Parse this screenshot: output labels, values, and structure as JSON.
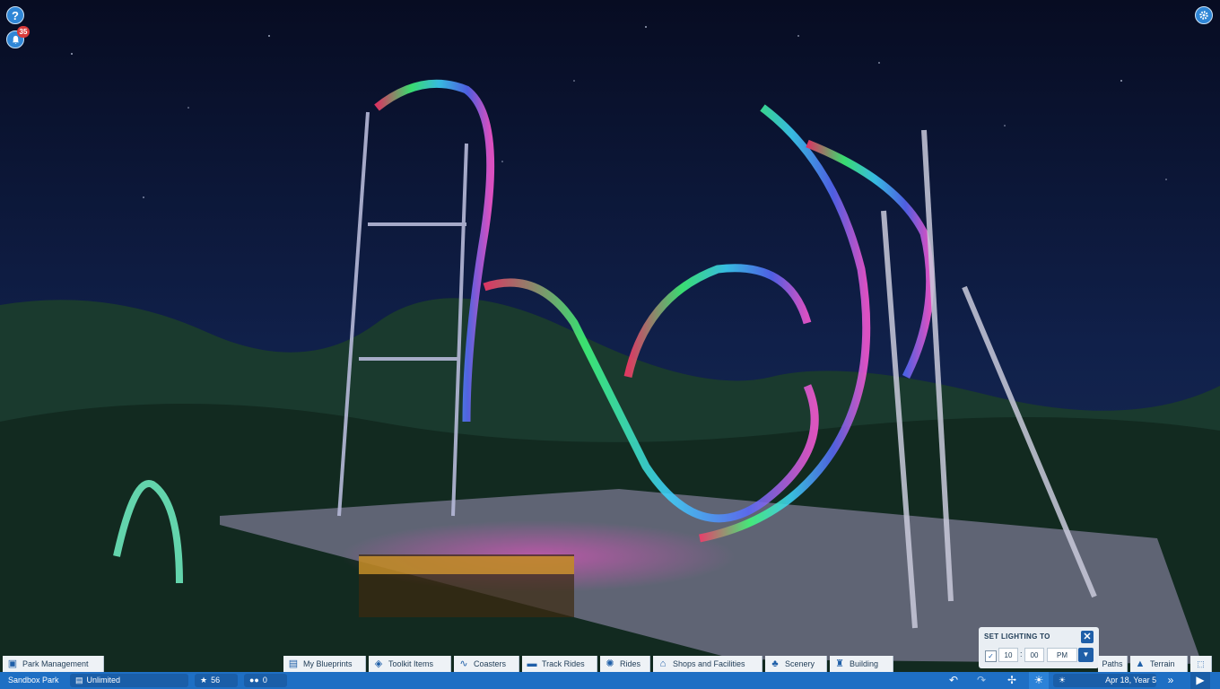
{
  "hud": {
    "help_icon": "question-mark-icon",
    "help_glyph": "?",
    "notification_icon": "bell-icon",
    "notification_count": "35",
    "settings_icon": "gear-icon"
  },
  "lighting_popup": {
    "title": "SET LIGHTING TO",
    "enabled": true,
    "hour": "10",
    "minute": "00",
    "period": "PM"
  },
  "toolbar": {
    "park_management": "Park Management",
    "my_blueprints": "My Blueprints",
    "toolkit_items": "Toolkit Items",
    "coasters": "Coasters",
    "track_rides": "Track Rides",
    "rides": "Rides",
    "shops_facilities": "Shops and Facilities",
    "scenery": "Scenery",
    "building": "Building",
    "paths": "Paths",
    "terrain": "Terrain"
  },
  "statusbar": {
    "park_name": "Sandbox Park",
    "money": "Unlimited",
    "rating": "56",
    "guests": "0",
    "date": "Apr 18, Year 5"
  },
  "colors": {
    "toolbar_bg": "#eef2f6",
    "statusbar_bg": "#1e6fc4",
    "accent": "#1f5fa8",
    "badge": "#d83b3b"
  }
}
